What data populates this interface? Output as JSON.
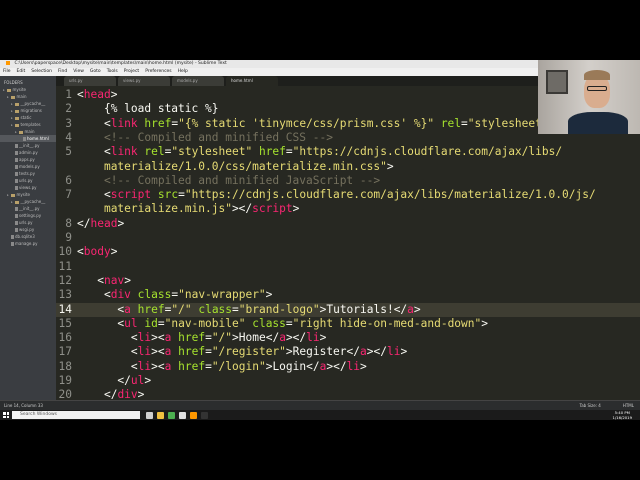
{
  "window": {
    "title": "C:\\Users\\paperspace\\Desktop\\mysite\\main\\templates\\main\\home.html (mysite) - Sublime Text",
    "controls": [
      "–",
      "☐",
      "✕"
    ]
  },
  "menu": [
    "File",
    "Edit",
    "Selection",
    "Find",
    "View",
    "Goto",
    "Tools",
    "Project",
    "Preferences",
    "Help"
  ],
  "sidebar": {
    "header": "FOLDERS",
    "items": [
      {
        "label": "mysite",
        "type": "folder",
        "depth": 0,
        "selected": false
      },
      {
        "label": "main",
        "type": "folder",
        "depth": 1,
        "selected": false
      },
      {
        "label": "__pycache__",
        "type": "folder",
        "depth": 2,
        "selected": false
      },
      {
        "label": "migrations",
        "type": "folder",
        "depth": 2,
        "selected": false
      },
      {
        "label": "static",
        "type": "folder",
        "depth": 2,
        "selected": false
      },
      {
        "label": "templates",
        "type": "folder",
        "depth": 2,
        "selected": false
      },
      {
        "label": "main",
        "type": "folder",
        "depth": 3,
        "selected": false
      },
      {
        "label": "home.html",
        "type": "file",
        "depth": 4,
        "selected": true
      },
      {
        "label": "__init__.py",
        "type": "file",
        "depth": 2,
        "selected": false
      },
      {
        "label": "admin.py",
        "type": "file",
        "depth": 2,
        "selected": false
      },
      {
        "label": "apps.py",
        "type": "file",
        "depth": 2,
        "selected": false
      },
      {
        "label": "models.py",
        "type": "file",
        "depth": 2,
        "selected": false
      },
      {
        "label": "tests.py",
        "type": "file",
        "depth": 2,
        "selected": false
      },
      {
        "label": "urls.py",
        "type": "file",
        "depth": 2,
        "selected": false
      },
      {
        "label": "views.py",
        "type": "file",
        "depth": 2,
        "selected": false
      },
      {
        "label": "mysite",
        "type": "folder",
        "depth": 1,
        "selected": false
      },
      {
        "label": "__pycache__",
        "type": "folder",
        "depth": 2,
        "selected": false
      },
      {
        "label": "__init__.py",
        "type": "file",
        "depth": 2,
        "selected": false
      },
      {
        "label": "settings.py",
        "type": "file",
        "depth": 2,
        "selected": false
      },
      {
        "label": "urls.py",
        "type": "file",
        "depth": 2,
        "selected": false
      },
      {
        "label": "wsgi.py",
        "type": "file",
        "depth": 2,
        "selected": false
      },
      {
        "label": "db.sqlite3",
        "type": "file",
        "depth": 1,
        "selected": false
      },
      {
        "label": "manage.py",
        "type": "file",
        "depth": 1,
        "selected": false
      }
    ]
  },
  "tabs": [
    {
      "label": "urls.py",
      "active": false
    },
    {
      "label": "views.py",
      "active": false
    },
    {
      "label": "models.py",
      "active": false
    },
    {
      "label": "home.html",
      "active": true
    }
  ],
  "editor": {
    "current_line": 14,
    "lines": [
      {
        "n": 1,
        "indent": 0,
        "tokens": [
          [
            "t",
            "<"
          ],
          [
            "tag",
            "head"
          ],
          [
            "t",
            ">"
          ]
        ]
      },
      {
        "n": 2,
        "indent": 4,
        "tokens": [
          [
            "t",
            "{% load static %}"
          ]
        ]
      },
      {
        "n": 3,
        "indent": 4,
        "tokens": [
          [
            "t",
            "<"
          ],
          [
            "tag",
            "link"
          ],
          [
            "t",
            " "
          ],
          [
            "attr",
            "href"
          ],
          [
            "t",
            "="
          ],
          [
            "str",
            "\"{% static 'tinymce/css/prism.css' %}\""
          ],
          [
            "t",
            " "
          ],
          [
            "attr",
            "rel"
          ],
          [
            "t",
            "="
          ],
          [
            "str",
            "\"stylesheet"
          ]
        ]
      },
      {
        "n": 4,
        "indent": 4,
        "tokens": [
          [
            "cmt",
            "<!-- Compiled and minified CSS -->"
          ]
        ]
      },
      {
        "n": 5,
        "indent": 4,
        "tokens": [
          [
            "t",
            "<"
          ],
          [
            "tag",
            "link"
          ],
          [
            "t",
            " "
          ],
          [
            "attr",
            "rel"
          ],
          [
            "t",
            "="
          ],
          [
            "str",
            "\"stylesheet\""
          ],
          [
            "t",
            " "
          ],
          [
            "attr",
            "href"
          ],
          [
            "t",
            "="
          ],
          [
            "str",
            "\"https://cdnjs.cloudflare.com/ajax/libs/"
          ]
        ]
      },
      {
        "n": null,
        "indent": 4,
        "tokens": [
          [
            "str",
            "materialize/1.0.0/css/materialize.min.css\""
          ],
          [
            "t",
            ">"
          ]
        ]
      },
      {
        "n": 6,
        "indent": 4,
        "tokens": [
          [
            "cmt",
            "<!-- Compiled and minified JavaScript -->"
          ]
        ]
      },
      {
        "n": 7,
        "indent": 4,
        "tokens": [
          [
            "t",
            "<"
          ],
          [
            "tag",
            "script"
          ],
          [
            "t",
            " "
          ],
          [
            "attr",
            "src"
          ],
          [
            "t",
            "="
          ],
          [
            "str",
            "\"https://cdnjs.cloudflare.com/ajax/libs/materialize/1.0.0/js/"
          ]
        ]
      },
      {
        "n": null,
        "indent": 4,
        "tokens": [
          [
            "str",
            "materialize.min.js\""
          ],
          [
            "t",
            "></"
          ],
          [
            "tag",
            "script"
          ],
          [
            "t",
            ">"
          ]
        ]
      },
      {
        "n": 8,
        "indent": 0,
        "tokens": [
          [
            "t",
            "</"
          ],
          [
            "tag",
            "head"
          ],
          [
            "t",
            ">"
          ]
        ]
      },
      {
        "n": 9,
        "indent": 0,
        "tokens": []
      },
      {
        "n": 10,
        "indent": 0,
        "tokens": [
          [
            "t",
            "<"
          ],
          [
            "tag",
            "body"
          ],
          [
            "t",
            ">"
          ]
        ]
      },
      {
        "n": 11,
        "indent": 0,
        "tokens": []
      },
      {
        "n": 12,
        "indent": 3,
        "tokens": [
          [
            "t",
            "<"
          ],
          [
            "tag",
            "nav"
          ],
          [
            "t",
            ">"
          ]
        ]
      },
      {
        "n": 13,
        "indent": 4,
        "tokens": [
          [
            "t",
            "<"
          ],
          [
            "tag",
            "div"
          ],
          [
            "t",
            " "
          ],
          [
            "attr",
            "class"
          ],
          [
            "t",
            "="
          ],
          [
            "str",
            "\"nav-wrapper\""
          ],
          [
            "t",
            ">"
          ]
        ]
      },
      {
        "n": 14,
        "indent": 6,
        "tokens": [
          [
            "t",
            "<"
          ],
          [
            "tag",
            "a"
          ],
          [
            "t",
            " "
          ],
          [
            "attr",
            "href"
          ],
          [
            "t",
            "="
          ],
          [
            "str",
            "\"/\""
          ],
          [
            "t",
            " "
          ],
          [
            "attr",
            "class"
          ],
          [
            "t",
            "="
          ],
          [
            "str",
            "\"brand-logo\""
          ],
          [
            "t",
            ">Tutorials!</"
          ],
          [
            "tag",
            "a"
          ],
          [
            "t",
            ">"
          ]
        ]
      },
      {
        "n": 15,
        "indent": 6,
        "tokens": [
          [
            "t",
            "<"
          ],
          [
            "tag",
            "ul"
          ],
          [
            "t",
            " "
          ],
          [
            "attr",
            "id"
          ],
          [
            "t",
            "="
          ],
          [
            "str",
            "\"nav-mobile\""
          ],
          [
            "t",
            " "
          ],
          [
            "attr",
            "class"
          ],
          [
            "t",
            "="
          ],
          [
            "str",
            "\"right hide-on-med-and-down\""
          ],
          [
            "t",
            ">"
          ]
        ]
      },
      {
        "n": 16,
        "indent": 8,
        "tokens": [
          [
            "t",
            "<"
          ],
          [
            "tag",
            "li"
          ],
          [
            "t",
            "><"
          ],
          [
            "tag",
            "a"
          ],
          [
            "t",
            " "
          ],
          [
            "attr",
            "href"
          ],
          [
            "t",
            "="
          ],
          [
            "str",
            "\"/\""
          ],
          [
            "t",
            ">Home</"
          ],
          [
            "tag",
            "a"
          ],
          [
            "t",
            "></"
          ],
          [
            "tag",
            "li"
          ],
          [
            "t",
            ">"
          ]
        ]
      },
      {
        "n": 17,
        "indent": 8,
        "tokens": [
          [
            "t",
            "<"
          ],
          [
            "tag",
            "li"
          ],
          [
            "t",
            "><"
          ],
          [
            "tag",
            "a"
          ],
          [
            "t",
            " "
          ],
          [
            "attr",
            "href"
          ],
          [
            "t",
            "="
          ],
          [
            "str",
            "\"/register\""
          ],
          [
            "t",
            ">Register</"
          ],
          [
            "tag",
            "a"
          ],
          [
            "t",
            "></"
          ],
          [
            "tag",
            "li"
          ],
          [
            "t",
            ">"
          ]
        ]
      },
      {
        "n": 18,
        "indent": 8,
        "tokens": [
          [
            "t",
            "<"
          ],
          [
            "tag",
            "li"
          ],
          [
            "t",
            "><"
          ],
          [
            "tag",
            "a"
          ],
          [
            "t",
            " "
          ],
          [
            "attr",
            "href"
          ],
          [
            "t",
            "="
          ],
          [
            "str",
            "\"/login\""
          ],
          [
            "t",
            ">Login</"
          ],
          [
            "tag",
            "a"
          ],
          [
            "t",
            "></"
          ],
          [
            "tag",
            "li"
          ],
          [
            "t",
            ">"
          ]
        ]
      },
      {
        "n": 19,
        "indent": 6,
        "tokens": [
          [
            "t",
            "</"
          ],
          [
            "tag",
            "ul"
          ],
          [
            "t",
            ">"
          ]
        ]
      },
      {
        "n": 20,
        "indent": 4,
        "tokens": [
          [
            "t",
            "</"
          ],
          [
            "tag",
            "div"
          ],
          [
            "t",
            ">"
          ]
        ]
      }
    ]
  },
  "statusbar": {
    "left": "Line 14, Column 33",
    "tab_size": "Tab Size: 4",
    "syntax": "HTML"
  },
  "taskbar": {
    "search_placeholder": "Search Windows",
    "time": "5:40 PM",
    "date": "1/16/2019",
    "icons": [
      {
        "name": "task-view-icon",
        "color": "#cfcfcf"
      },
      {
        "name": "explorer-icon",
        "color": "#f0c040"
      },
      {
        "name": "chrome-icon",
        "color": "#4caf50"
      },
      {
        "name": "notepad-icon",
        "color": "#e0e0e0"
      },
      {
        "name": "sublime-icon",
        "color": "#ff9800"
      },
      {
        "name": "cmd-icon",
        "color": "#333333"
      }
    ]
  }
}
